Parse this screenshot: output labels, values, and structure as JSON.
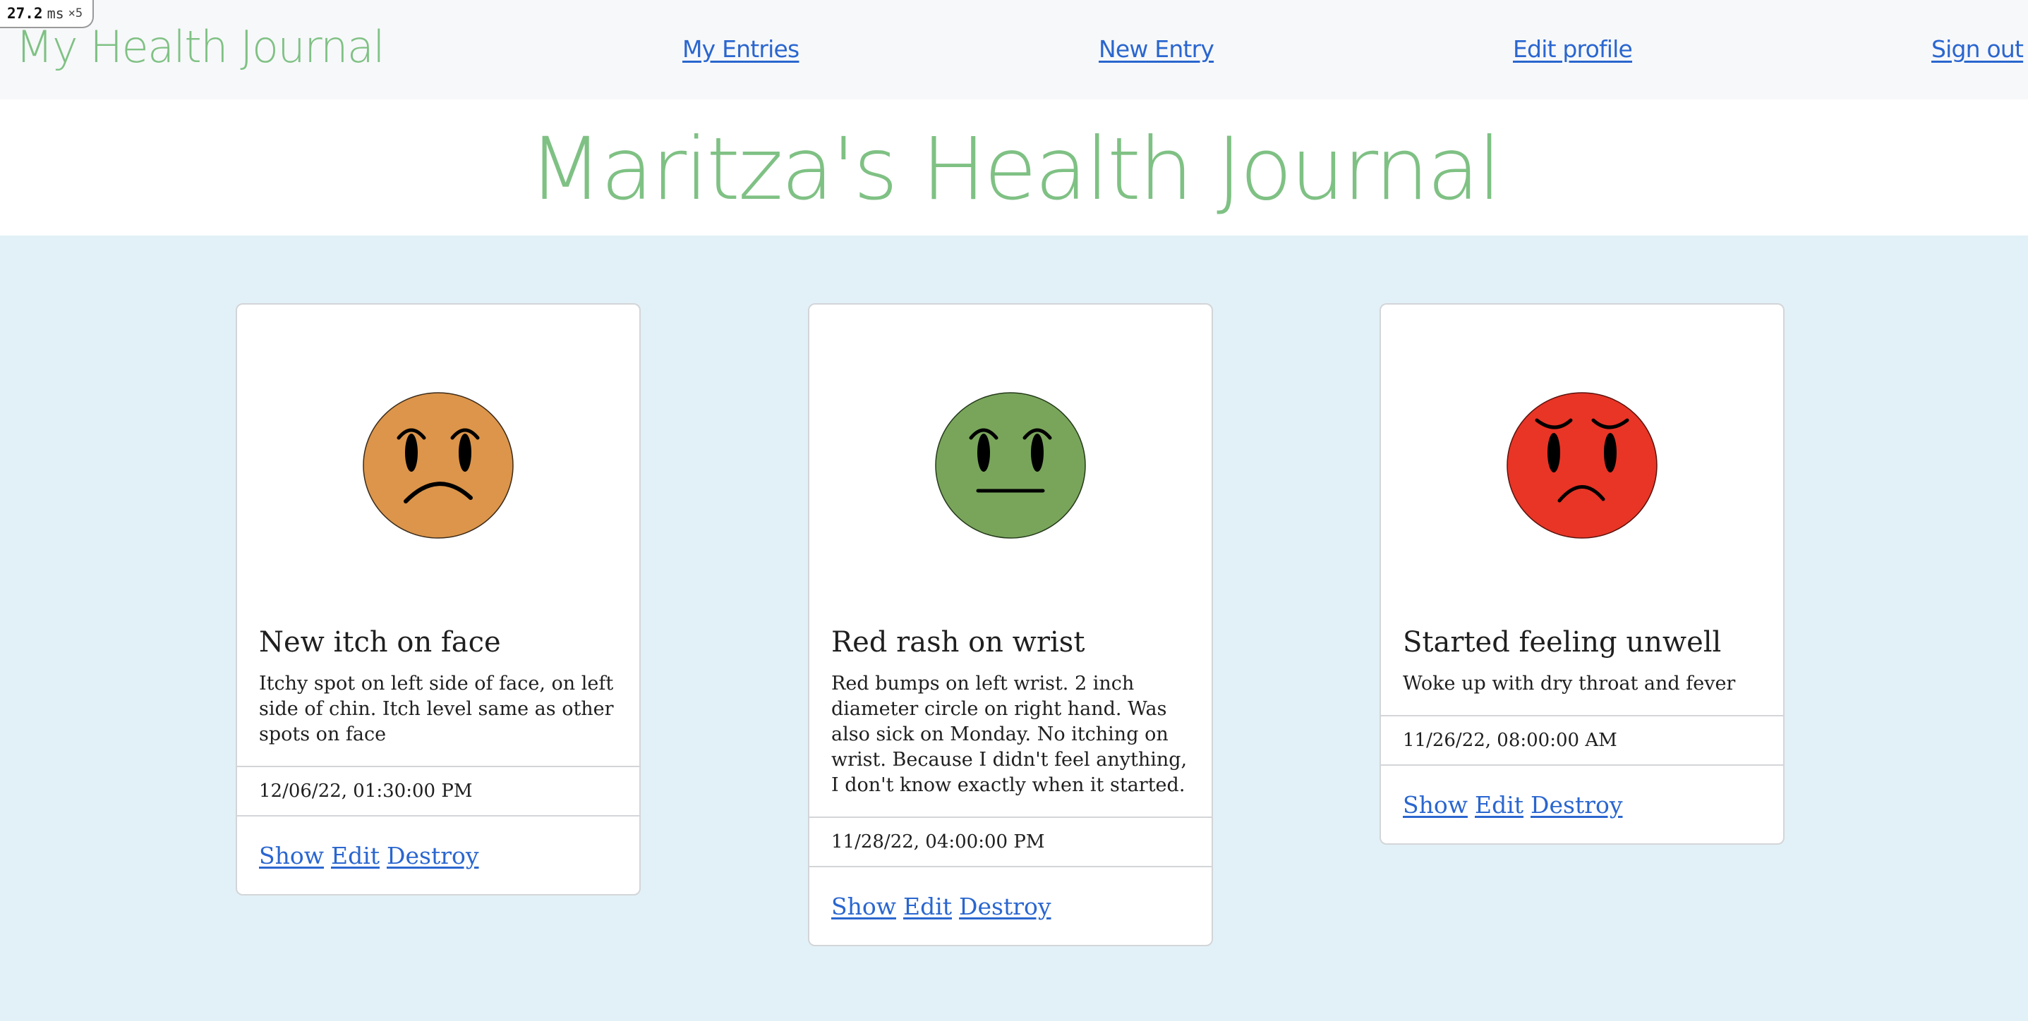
{
  "perf": {
    "value": "27.2",
    "unit": "ms",
    "multiplier": "×5"
  },
  "nav": {
    "brand": "My Health Journal",
    "links": [
      "My Entries",
      "New Entry",
      "Edit profile",
      "Sign out"
    ]
  },
  "page_title": "Maritza's Health Journal",
  "entries": [
    {
      "mood_icon": "sad-face-icon",
      "mood_color": "#dc954a",
      "title": "New itch on face",
      "body": "Itchy spot on left side of face, on left side of chin. Itch level same as other spots on face",
      "timestamp": "12/06/22, 01:30:00 PM",
      "actions": [
        "Show",
        "Edit",
        "Destroy"
      ]
    },
    {
      "mood_icon": "neutral-face-icon",
      "mood_color": "#79a55b",
      "title": "Red rash on wrist",
      "body": "Red bumps on left wrist. 2 inch diameter circle on right hand. Was also sick on Monday. No itching on wrist. Because I didn't feel anything, I don't know exactly when it started.",
      "timestamp": "11/28/22, 04:00:00 PM",
      "actions": [
        "Show",
        "Edit",
        "Destroy"
      ]
    },
    {
      "mood_icon": "angry-face-icon",
      "mood_color": "#e83526",
      "title": "Started feeling unwell",
      "body": "Woke up with dry throat and fever",
      "timestamp": "11/26/22, 08:00:00 AM",
      "actions": [
        "Show",
        "Edit",
        "Destroy"
      ]
    }
  ]
}
